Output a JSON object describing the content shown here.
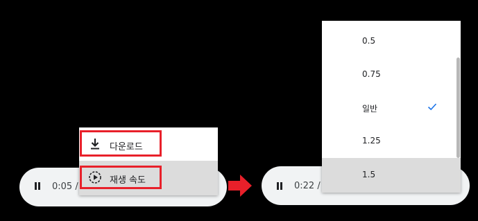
{
  "left_player": {
    "time": "0:05 /",
    "pause_icon": "pause-icon"
  },
  "context_menu": {
    "items": [
      {
        "label": "다운로드",
        "icon": "download-icon"
      },
      {
        "label": "재생 속도",
        "icon": "playback-speed-icon"
      }
    ]
  },
  "right_player": {
    "time": "0:22 /",
    "pause_icon": "pause-icon"
  },
  "speed_menu": {
    "options": [
      {
        "label": "0.5"
      },
      {
        "label": "0.75"
      },
      {
        "label": "일반",
        "selected": true
      },
      {
        "label": "1.25"
      },
      {
        "label": "1.5",
        "hovered": true
      }
    ],
    "check_icon": "check-icon"
  },
  "colors": {
    "highlight_red": "#e8202a",
    "check_blue": "#1a73e8",
    "menu_hover_gray": "#dcdcdc",
    "player_bg": "#f1f3f4"
  }
}
